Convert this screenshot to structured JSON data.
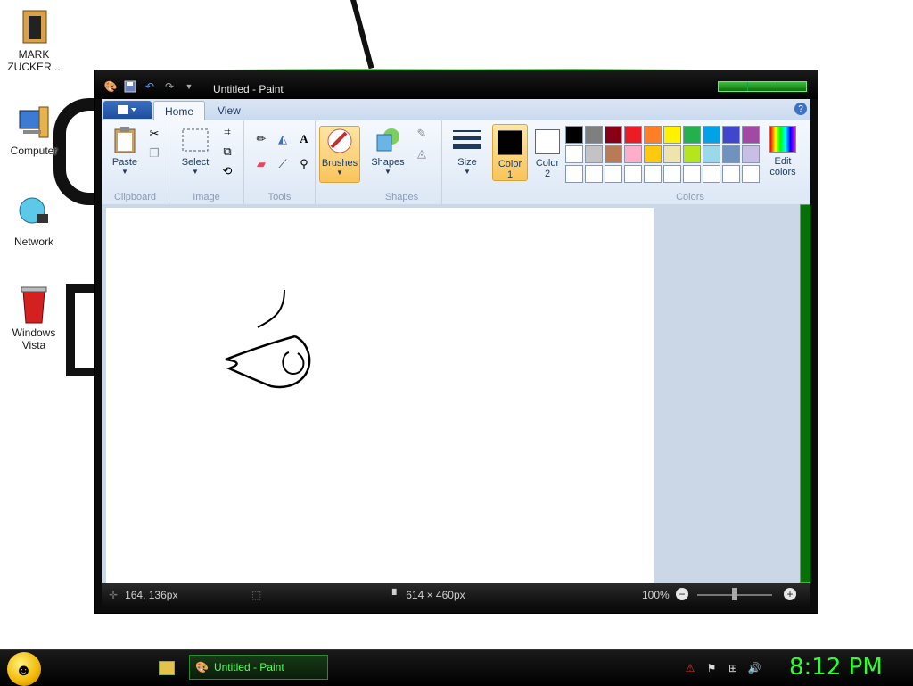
{
  "desktop": {
    "icons": [
      {
        "label": "MARK\nZUCKER...",
        "icon": "user-folder-icon"
      },
      {
        "label": "Computer",
        "icon": "computer-icon"
      },
      {
        "label": "Network",
        "icon": "network-globe-icon"
      },
      {
        "label": "Windows\nVista",
        "icon": "recycle-bin-icon"
      }
    ]
  },
  "window": {
    "title": "Untitled - Paint",
    "tabs": [
      {
        "label": "Home",
        "active": true
      },
      {
        "label": "View",
        "active": false
      }
    ],
    "help_label": "?",
    "ribbon": {
      "clipboard": {
        "group_label": "Clipboard",
        "paste_label": "Paste"
      },
      "image": {
        "group_label": "Image",
        "select_label": "Select"
      },
      "tools": {
        "group_label": "Tools"
      },
      "brushes_label": "Brushes",
      "shapes": {
        "group_label": "Shapes",
        "shapes_label": "Shapes"
      },
      "size_label": "Size",
      "color1_label": "Color\n1",
      "color2_label": "Color\n2",
      "colors": {
        "group_label": "Colors",
        "edit_label": "Edit\ncolors"
      },
      "color1_value": "#000000",
      "color2_value": "#ffffff",
      "palette": [
        "#000000",
        "#7f7f7f",
        "#880015",
        "#ed1c24",
        "#ff7f27",
        "#fff200",
        "#22b14c",
        "#00a2e8",
        "#3f48cc",
        "#a349a4",
        "#ffffff",
        "#c3c3c3",
        "#b97a57",
        "#ffaec9",
        "#ffc90e",
        "#efe4b0",
        "#b5e61d",
        "#99d9ea",
        "#7092be",
        "#c8bfe7",
        "#ffffff",
        "#ffffff",
        "#ffffff",
        "#ffffff",
        "#ffffff",
        "#ffffff",
        "#ffffff",
        "#ffffff",
        "#ffffff",
        "#ffffff"
      ]
    },
    "status": {
      "cursor_pos": "164, 136px",
      "canvas_size": "614 × 460px",
      "zoom": "100%"
    }
  },
  "taskbar": {
    "task_label": "Untitled - Paint",
    "clock": "8:12 PM"
  },
  "colors": {
    "accent_green": "#2bff2b",
    "ribbon_blue": "#dce7f5"
  }
}
